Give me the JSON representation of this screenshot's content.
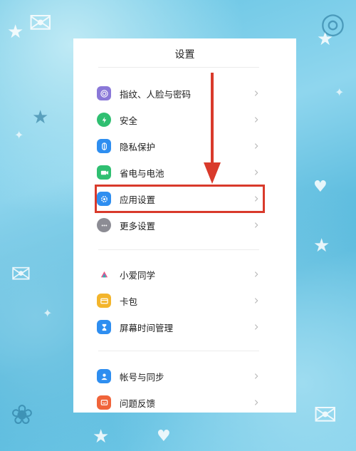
{
  "header": {
    "title": "设置"
  },
  "groups": [
    {
      "items": [
        {
          "label": "指纹、人脸与密码",
          "icon": "fingerprint-icon",
          "color": "#8a78d8"
        },
        {
          "label": "安全",
          "icon": "shield-icon",
          "color": "#2fbf71"
        },
        {
          "label": "隐私保护",
          "icon": "privacy-icon",
          "color": "#2e8ef0"
        },
        {
          "label": "省电与电池",
          "icon": "battery-icon",
          "color": "#2fbf71"
        },
        {
          "label": "应用设置",
          "icon": "gear-icon",
          "color": "#2e8ef0"
        },
        {
          "label": "更多设置",
          "icon": "more-icon",
          "color": "#8c8c94"
        }
      ]
    },
    {
      "items": [
        {
          "label": "小爱同学",
          "icon": "xiaoai-icon",
          "color": "#ffffff"
        },
        {
          "label": "卡包",
          "icon": "wallet-icon",
          "color": "#f3b52c"
        },
        {
          "label": "屏幕时间管理",
          "icon": "hourglass-icon",
          "color": "#2e8ef0"
        }
      ]
    },
    {
      "items": [
        {
          "label": "帐号与同步",
          "icon": "account-icon",
          "color": "#2e8ef0"
        },
        {
          "label": "问题反馈",
          "icon": "feedback-icon",
          "color": "#f0643a"
        }
      ]
    }
  ],
  "annotation": {
    "highlight_color": "#d93a2b",
    "highlighted_item": "应用设置"
  }
}
